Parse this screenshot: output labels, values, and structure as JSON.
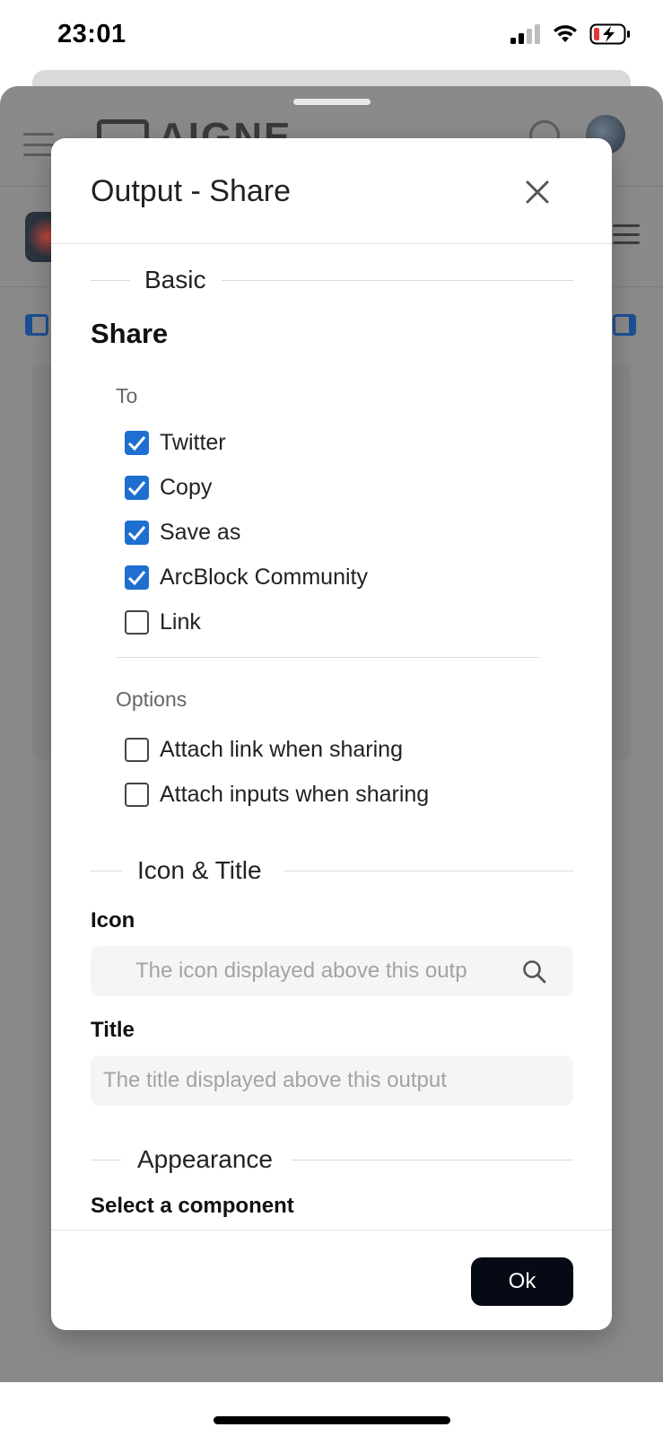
{
  "status_bar": {
    "time": "23:01"
  },
  "app": {
    "logo_text": "AIGNE"
  },
  "dialog": {
    "title": "Output - Share",
    "ok_label": "Ok",
    "sections": {
      "basic": "Basic",
      "icon_title": "Icon & Title",
      "appearance": "Appearance"
    },
    "share": {
      "title": "Share",
      "to_label": "To",
      "targets": [
        {
          "label": "Twitter",
          "checked": true
        },
        {
          "label": "Copy",
          "checked": true
        },
        {
          "label": "Save as",
          "checked": true
        },
        {
          "label": "ArcBlock Community",
          "checked": true
        },
        {
          "label": "Link",
          "checked": false
        }
      ],
      "options_label": "Options",
      "options": [
        {
          "label": "Attach link when sharing",
          "checked": false
        },
        {
          "label": "Attach inputs when sharing",
          "checked": false
        }
      ]
    },
    "icon_field": {
      "label": "Icon",
      "placeholder": "The icon displayed above this outp",
      "icon": "search-icon"
    },
    "title_field": {
      "label": "Title",
      "placeholder": "The title displayed above this output"
    },
    "appearance_cut_label": "Select a component"
  },
  "colors": {
    "accent": "#1e6fd0",
    "ok_button": "#050a14",
    "overlay": "#8a8a8a"
  }
}
